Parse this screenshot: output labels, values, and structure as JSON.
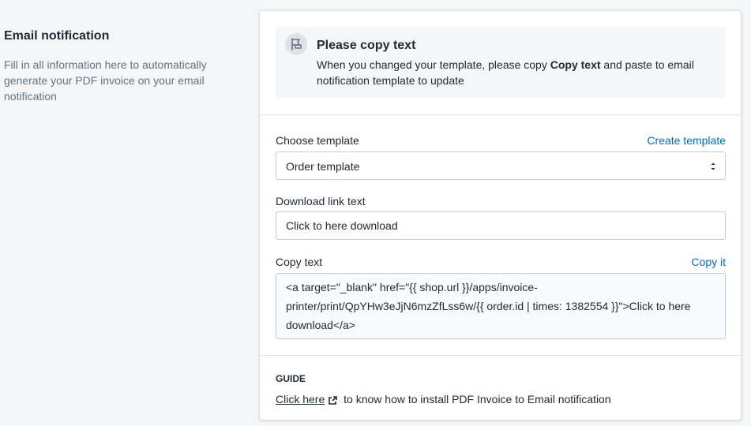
{
  "annotation": {
    "title": "Email notification",
    "description": "Fill in all information here to automatically generate your PDF invoice on your email notification"
  },
  "banner": {
    "icon": "flag-icon",
    "title": "Please copy text",
    "body_before": "When you changed your template, please copy ",
    "body_bold": "Copy text",
    "body_after": " and paste to email notification template to update"
  },
  "template": {
    "label": "Choose template",
    "action": "Create template",
    "selected": "Order template"
  },
  "download_link": {
    "label": "Download link text",
    "value": "Click to here download"
  },
  "copy_text": {
    "label": "Copy text",
    "action": "Copy it",
    "value": "<a target=\"_blank\" href=\"{{ shop.url }}/apps/invoice-printer/print/QpYHw3eJjN6mzZfLss6w/{{ order.id | times: 1382554 }}\">Click to here download</a>"
  },
  "guide": {
    "title": "GUIDE",
    "link": "Click here",
    "link_icon": "external-link-icon",
    "text": " to know how to install PDF Invoice to Email notification"
  },
  "colors": {
    "accent": "#006fbb",
    "background": "#f4f6f8",
    "border": "#dfe3e8"
  }
}
